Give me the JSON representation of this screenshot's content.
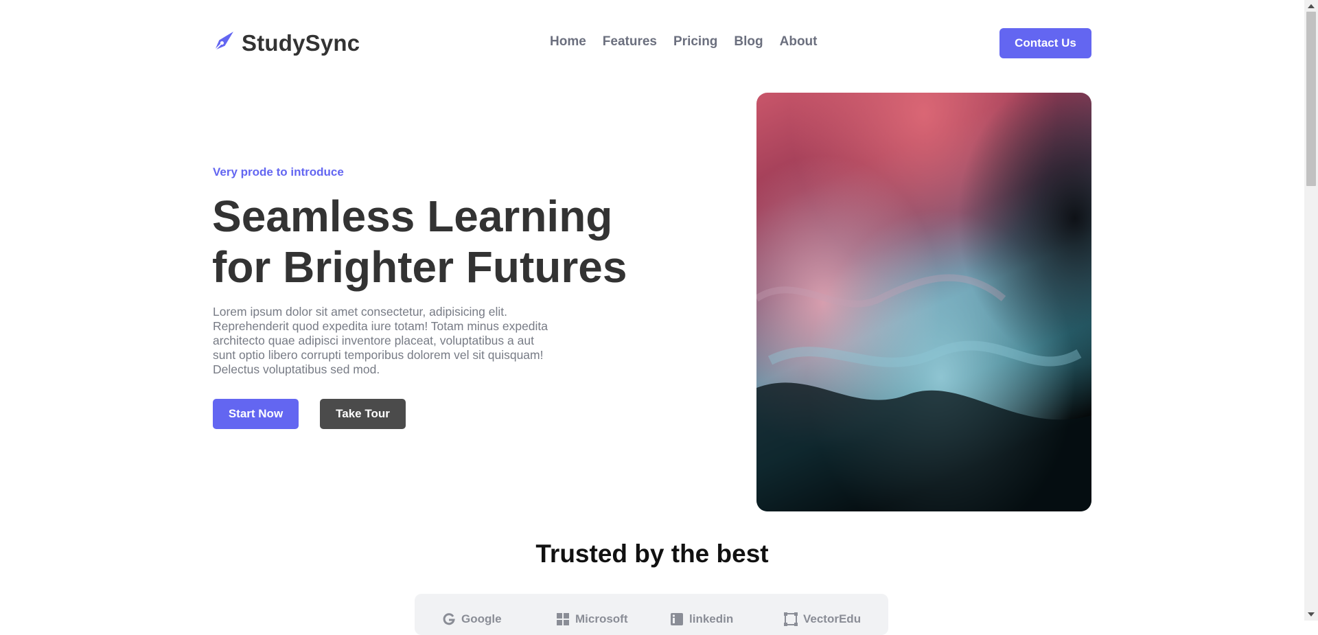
{
  "brand": {
    "name": "StudySync",
    "icon": "pen-nib-icon",
    "accent": "#6366f1"
  },
  "nav": {
    "links": [
      "Home",
      "Features",
      "Pricing",
      "Blog",
      "About"
    ],
    "contact_label": "Contact Us"
  },
  "hero": {
    "eyebrow": "Very prode to introduce",
    "headline_line1": "Seamless Learning",
    "headline_line2": "for Brighter Futures",
    "description": "Lorem ipsum dolor sit amet consectetur, adipisicing elit. Reprehenderit quod expedita iure totam! Totam minus expedita architecto quae adipisci inventore placeat, voluptatibus a aut sunt optio libero corrupti temporibus dolorem vel sit quisquam! Delectus voluptatibus sed mod.",
    "start_label": "Start Now",
    "tour_label": "Take Tour",
    "image_alt": "abstract red and teal fluid art"
  },
  "trusted": {
    "title": "Trusted by the best",
    "logos": [
      {
        "name": "Google",
        "icon": "google-icon"
      },
      {
        "name": "Microsoft",
        "icon": "microsoft-icon"
      },
      {
        "name": "linkedin",
        "icon": "linkedin-icon"
      },
      {
        "name": "VectorEdu",
        "icon": "vector-icon"
      }
    ]
  },
  "colors": {
    "primary": "#6366f1",
    "dark_button": "#4b4b4b",
    "text": "#333333",
    "muted": "#777b85"
  }
}
